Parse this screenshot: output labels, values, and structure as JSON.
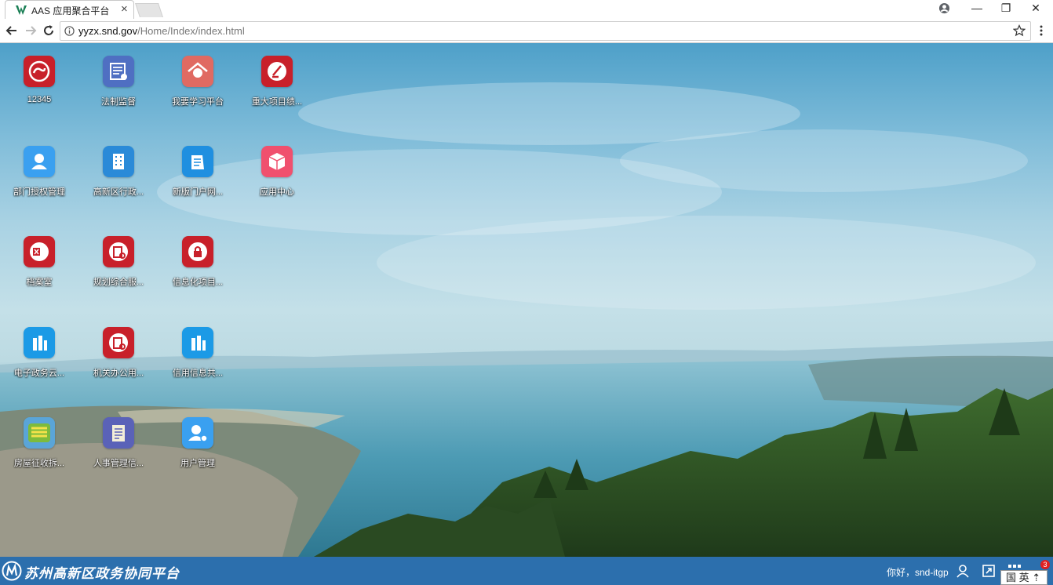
{
  "browser": {
    "tab_title": "AAS 应用聚合平台",
    "tab_close": "×",
    "url_host": "yyzx.snd.gov",
    "url_path": "/Home/Index/index.html",
    "window_controls": [
      "—",
      "❐",
      "✕"
    ]
  },
  "desktop": {
    "apps": [
      {
        "label": "12345",
        "icon": "hotline-icon",
        "color": "#c8202a"
      },
      {
        "label": "法制监督",
        "icon": "legal-supervision-icon",
        "color": "#4f6fc2"
      },
      {
        "label": "我要学习平台",
        "icon": "study-platform-icon",
        "color": "#e06a62"
      },
      {
        "label": "重大项目绩...",
        "icon": "major-project-icon",
        "color": "#c8202a"
      },
      {
        "label": "部门授权管理",
        "icon": "department-auth-icon",
        "color": "#3aa0f0"
      },
      {
        "label": "高新区行政...",
        "icon": "admin-building-icon",
        "color": "#2a8ad8"
      },
      {
        "label": "新版门户网...",
        "icon": "new-portal-icon",
        "color": "#1f8fe0"
      },
      {
        "label": "应用中心",
        "icon": "app-center-icon",
        "color": "#f0506e"
      },
      {
        "label": "档案室",
        "icon": "archive-room-icon",
        "color": "#c8202a"
      },
      {
        "label": "规划综合服...",
        "icon": "planning-service-icon",
        "color": "#c8202a"
      },
      {
        "label": "信息化项目...",
        "icon": "it-project-icon",
        "color": "#c8202a"
      },
      {
        "label": "电子政务云...",
        "icon": "egov-cloud-icon",
        "color": "#1b9ae6"
      },
      {
        "label": "机关办公用...",
        "icon": "office-supplies-icon",
        "color": "#c8202a"
      },
      {
        "label": "信用信息共...",
        "icon": "credit-info-icon",
        "color": "#1b9ae6"
      },
      {
        "label": "房屋征收拆...",
        "icon": "house-requisition-icon",
        "color": "#5aa5d8"
      },
      {
        "label": "人事管理信...",
        "icon": "hr-management-icon",
        "color": "#5a62b8"
      },
      {
        "label": "用户管理",
        "icon": "user-management-icon",
        "color": "#3aa0f0"
      }
    ]
  },
  "taskbar": {
    "brand": "苏州高新区政务协同平台",
    "greeting": "你好，snd-itgp",
    "notification_count": "3",
    "ime_label": "国 英 ⇡"
  }
}
